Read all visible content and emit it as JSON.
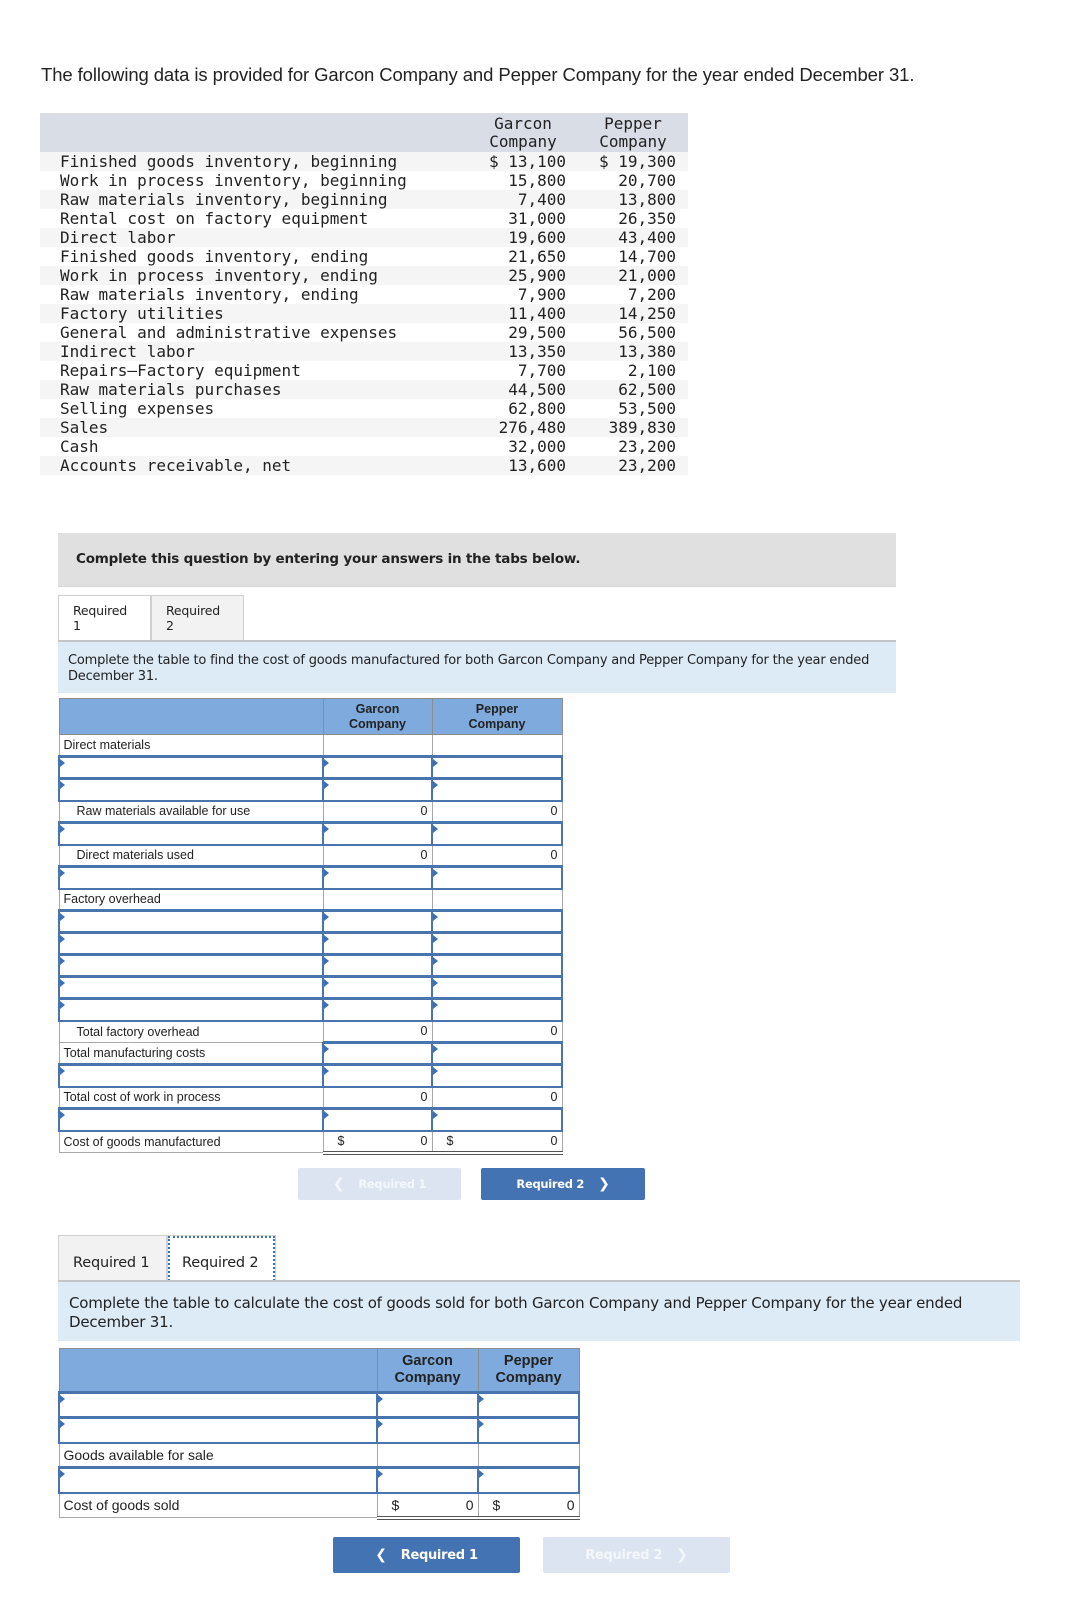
{
  "intro": "The following data is provided for Garcon Company and Pepper Company for the year ended December 31.",
  "data_table": {
    "headers": {
      "garcon": [
        "Garcon",
        "Company"
      ],
      "pepper": [
        "Pepper",
        "Company"
      ]
    },
    "rows": [
      {
        "label": "Finished goods inventory, beginning",
        "garcon": "$ 13,100",
        "pepper": "$ 19,300"
      },
      {
        "label": "Work in process inventory, beginning",
        "garcon": "15,800",
        "pepper": "20,700"
      },
      {
        "label": "Raw materials inventory, beginning",
        "garcon": "7,400",
        "pepper": "13,800"
      },
      {
        "label": "Rental cost on factory equipment",
        "garcon": "31,000",
        "pepper": "26,350"
      },
      {
        "label": "Direct labor",
        "garcon": "19,600",
        "pepper": "43,400"
      },
      {
        "label": "Finished goods inventory, ending",
        "garcon": "21,650",
        "pepper": "14,700"
      },
      {
        "label": "Work in process inventory, ending",
        "garcon": "25,900",
        "pepper": "21,000"
      },
      {
        "label": "Raw materials inventory, ending",
        "garcon": "7,900",
        "pepper": "7,200"
      },
      {
        "label": "Factory utilities",
        "garcon": "11,400",
        "pepper": "14,250"
      },
      {
        "label": "General and administrative expenses",
        "garcon": "29,500",
        "pepper": "56,500"
      },
      {
        "label": "Indirect labor",
        "garcon": "13,350",
        "pepper": "13,380"
      },
      {
        "label": "Repairs—Factory equipment",
        "garcon": "7,700",
        "pepper": "2,100"
      },
      {
        "label": "Raw materials purchases",
        "garcon": "44,500",
        "pepper": "62,500"
      },
      {
        "label": "Selling expenses",
        "garcon": "62,800",
        "pepper": "53,500"
      },
      {
        "label": "Sales",
        "garcon": "276,480",
        "pepper": "389,830"
      },
      {
        "label": "Cash",
        "garcon": "32,000",
        "pepper": "23,200"
      },
      {
        "label": "Accounts receivable, net",
        "garcon": "13,600",
        "pepper": "23,200"
      }
    ]
  },
  "instructions": "Complete this question by entering your answers in the tabs below.",
  "tabs": [
    "Required 1",
    "Required 2"
  ],
  "required1": {
    "prompt": "Complete the table to find the cost of goods manufactured for both Garcon Company and Pepper Company for the year ended December 31.",
    "headers": {
      "garcon": [
        "Garcon",
        "Company"
      ],
      "pepper": [
        "Pepper",
        "Company"
      ]
    },
    "labels": {
      "direct_materials": "Direct materials",
      "raw_available": "Raw materials available for use",
      "dm_used": "Direct materials used",
      "factory_overhead": "Factory overhead",
      "total_overhead": "Total factory overhead",
      "total_mfg": "Total manufacturing costs",
      "total_wip": "Total cost of work in process",
      "cogm": "Cost of goods manufactured"
    },
    "values": {
      "raw_available": {
        "garcon": "0",
        "pepper": "0"
      },
      "dm_used": {
        "garcon": "0",
        "pepper": "0"
      },
      "total_overhead": {
        "garcon": "0",
        "pepper": "0"
      },
      "total_wip": {
        "garcon": "0",
        "pepper": "0"
      },
      "cogm": {
        "garcon": "0",
        "pepper": "0"
      }
    },
    "currency": "$",
    "nav_prev": "Required 1",
    "nav_next": "Required 2"
  },
  "required2": {
    "prompt": "Complete the table to calculate the cost of goods sold for both Garcon Company and Pepper Company for the year ended December 31.",
    "headers": {
      "garcon": [
        "Garcon",
        "Company"
      ],
      "pepper": [
        "Pepper",
        "Company"
      ]
    },
    "labels": {
      "goods_available": "Goods available for sale",
      "cogs": "Cost of goods sold"
    },
    "values": {
      "cogs": {
        "garcon": "0",
        "pepper": "0"
      }
    },
    "currency": "$",
    "nav_prev": "Required 1",
    "nav_next": "Required 2"
  },
  "icons": {
    "prev": "chevron-left-icon",
    "next": "chevron-right-icon"
  },
  "colors": {
    "header_blue": "#7faadd",
    "input_border": "#4a74ad",
    "button_active": "#4373b3",
    "prompt_bg": "#ddebf7"
  }
}
